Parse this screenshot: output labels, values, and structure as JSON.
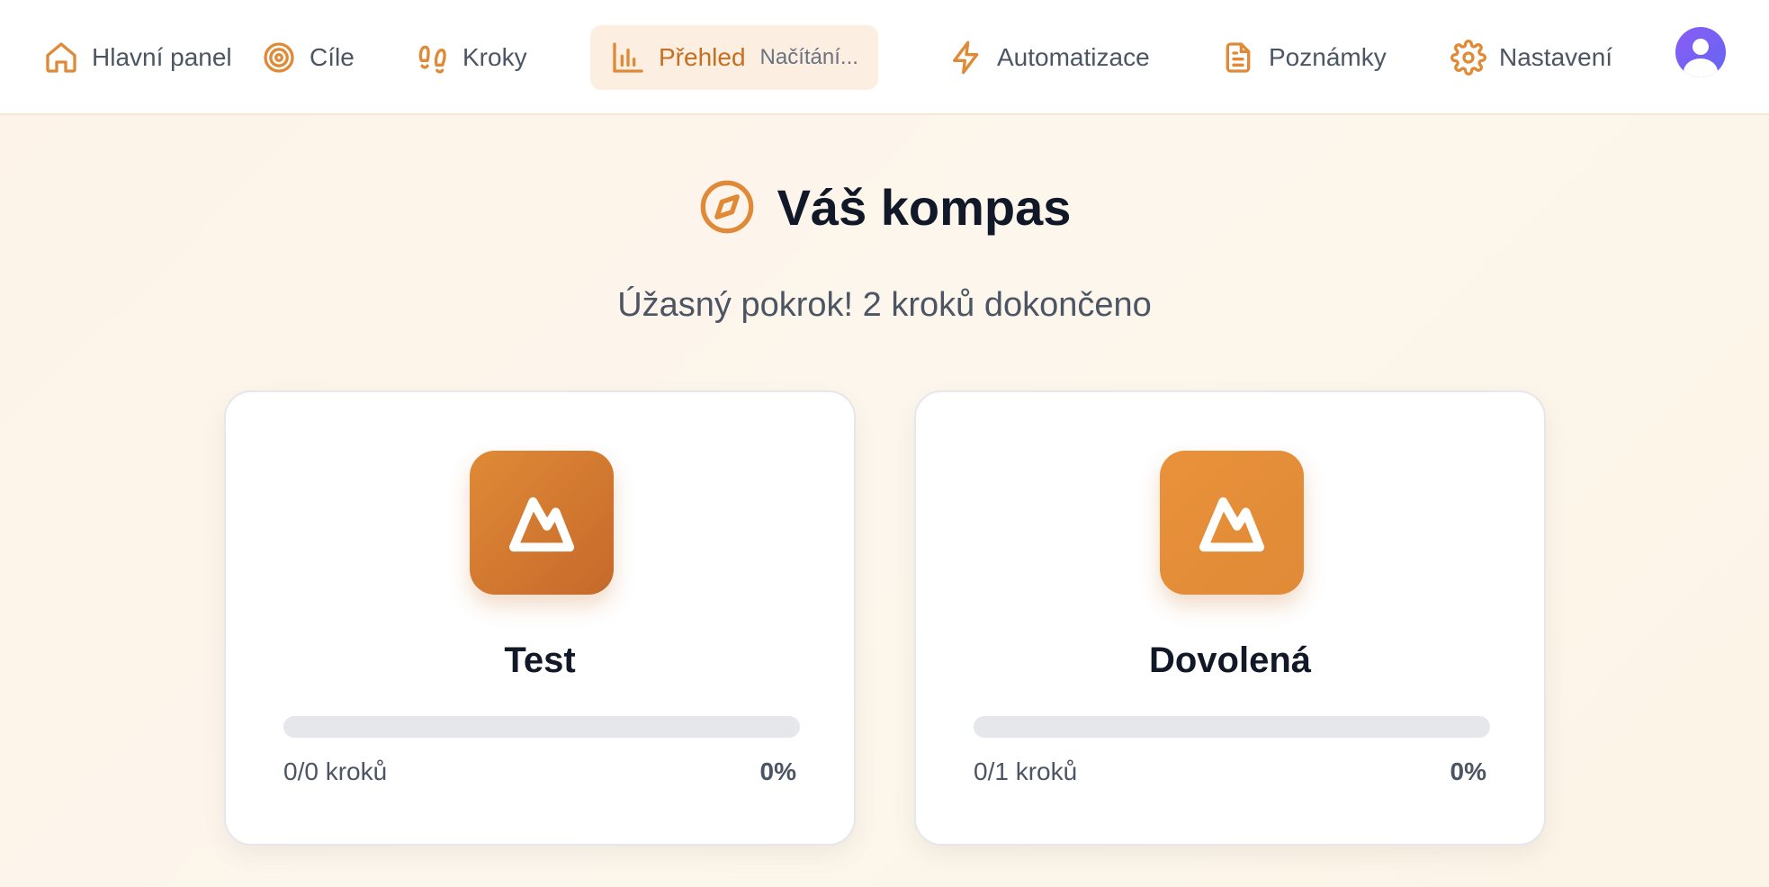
{
  "nav": {
    "items": [
      {
        "label": "Hlavní panel",
        "icon": "home-icon"
      },
      {
        "label": "Cíle",
        "icon": "target-icon"
      },
      {
        "label": "Kroky",
        "icon": "footprints-icon"
      },
      {
        "label": "Přehled",
        "sub": "Načítání...",
        "icon": "bar-chart-icon",
        "active": true
      },
      {
        "label": "Automatizace",
        "icon": "lightning-icon"
      },
      {
        "label": "Poznámky",
        "icon": "document-icon"
      },
      {
        "label": "Nastavení",
        "icon": "gear-icon"
      }
    ],
    "avatar": "user-avatar"
  },
  "page": {
    "title": "Váš kompas",
    "title_icon": "compass-icon",
    "subtitle": "Úžasný pokrok! 2 kroků dokončeno"
  },
  "goals": [
    {
      "name": "Test",
      "steps": "0/0 kroků",
      "percent": "0%",
      "progress": 0,
      "icon": "mountain-icon",
      "badge_colors": [
        "#e08a37",
        "#c5692a"
      ]
    },
    {
      "name": "Dovolená",
      "steps": "0/1 kroků",
      "percent": "0%",
      "progress": 0,
      "icon": "mountain-icon",
      "badge_colors": [
        "#e9913a",
        "#e08a37"
      ]
    }
  ],
  "colors": {
    "accent": "#e08a37",
    "active_bg": "#fcefe1",
    "active_text": "#c66f21"
  }
}
